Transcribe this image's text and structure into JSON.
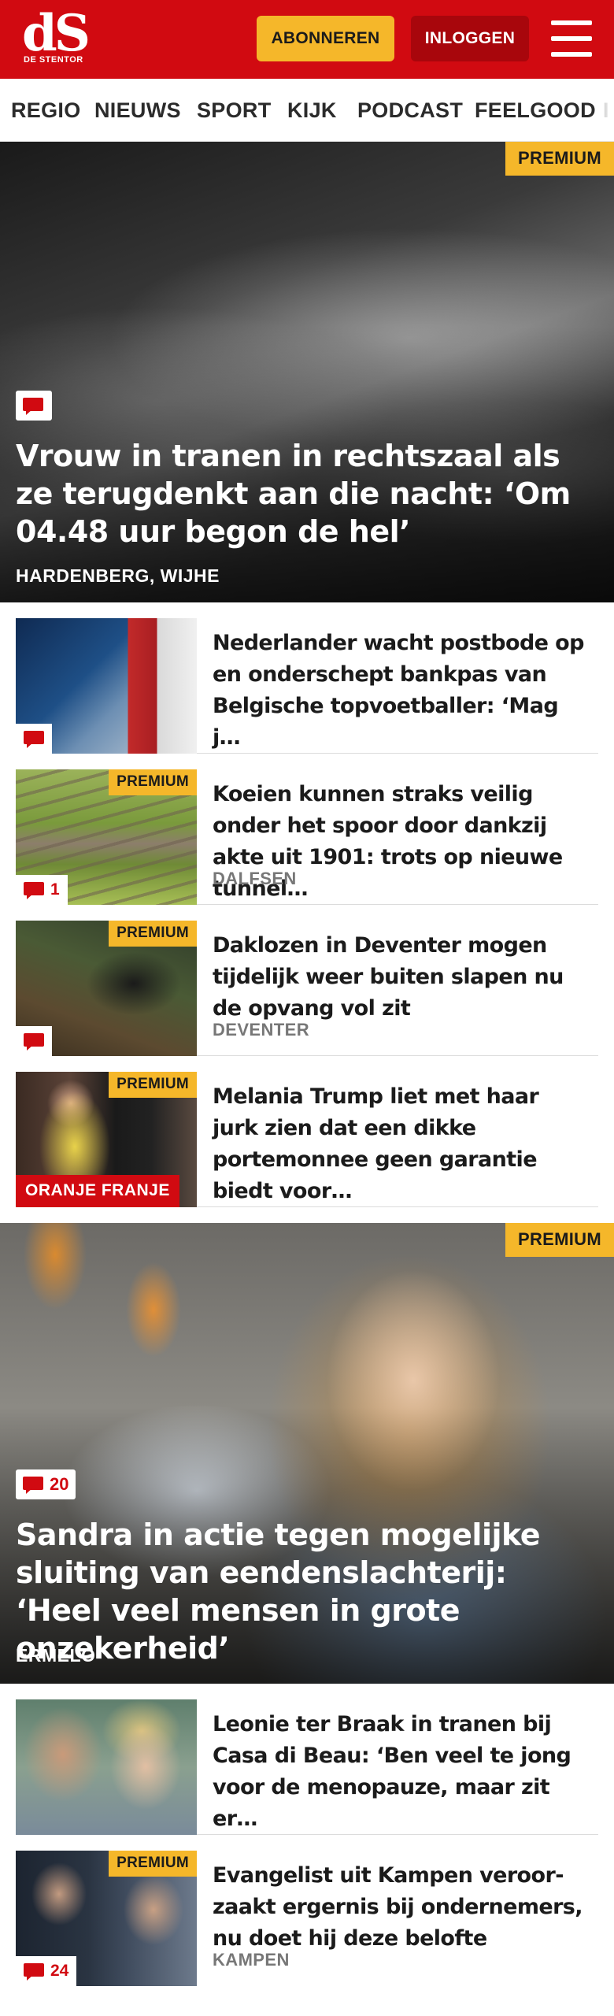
{
  "header": {
    "logo_text": "dS",
    "logo_sub": "DE STENTOR",
    "subscribe_label": "ABONNEREN",
    "login_label": "INLOGGEN",
    "brand_color": "#d10a11",
    "accent_color": "#f5b72a"
  },
  "nav": {
    "items": [
      {
        "label": "REGIO"
      },
      {
        "label": "NIEUWS"
      },
      {
        "label": "SPORT"
      },
      {
        "label": "KIJK"
      },
      {
        "label": "PODCAST"
      },
      {
        "label": "FEELGOOD"
      }
    ]
  },
  "hero1": {
    "badge": "PREMIUM",
    "title": "Vrouw in tranen in rechtszaal als ze terugdenkt aan die nacht: ‘Om 04.48 uur begon de hel’",
    "location": "HARDENBERG, WIJHE",
    "comments": ""
  },
  "articles1": [
    {
      "title": "Nederlander wacht postbode op en onderschept bankpas van Belgische topvoetballer: ‘Mag j…",
      "premium": "",
      "location": "",
      "comments": ""
    },
    {
      "title": "Koeien kunnen straks veilig onder het spoor door dankzij akte uit 1901: trots op nieuwe tunnel…",
      "premium": "PREMIUM",
      "location": "DALFSEN",
      "comments": "1"
    },
    {
      "title": "Daklozen in Deventer mogen tijdelijk weer buiten slapen nu de opvang vol zit",
      "premium": "PREMIUM",
      "location": "DEVENTER",
      "comments": ""
    },
    {
      "title": "Melania Trump liet met haar jurk zien dat een dikke portemonnee geen garantie biedt voor…",
      "premium": "PREMIUM",
      "location": "",
      "label": "ORANJE FRANJE"
    }
  ],
  "hero2": {
    "badge": "PREMIUM",
    "title": "Sandra in actie tegen mogelijke sluiting van eendenslachterij: ‘Heel veel mensen in grote onzekerheid’",
    "location": "ERMELO",
    "comments": "20"
  },
  "articles2": [
    {
      "title": "Leonie ter Braak in tranen bij Casa di Beau: ‘Ben veel te jong voor de menopauze, maar zit er…",
      "premium": "",
      "location": "",
      "comments": ""
    },
    {
      "title": "Evangelist uit Kampen veroor­zaakt ergernis bij ondernemers, nu doet hij deze belofte",
      "premium": "PREMIUM",
      "location": "KAMPEN",
      "comments": "24"
    }
  ]
}
